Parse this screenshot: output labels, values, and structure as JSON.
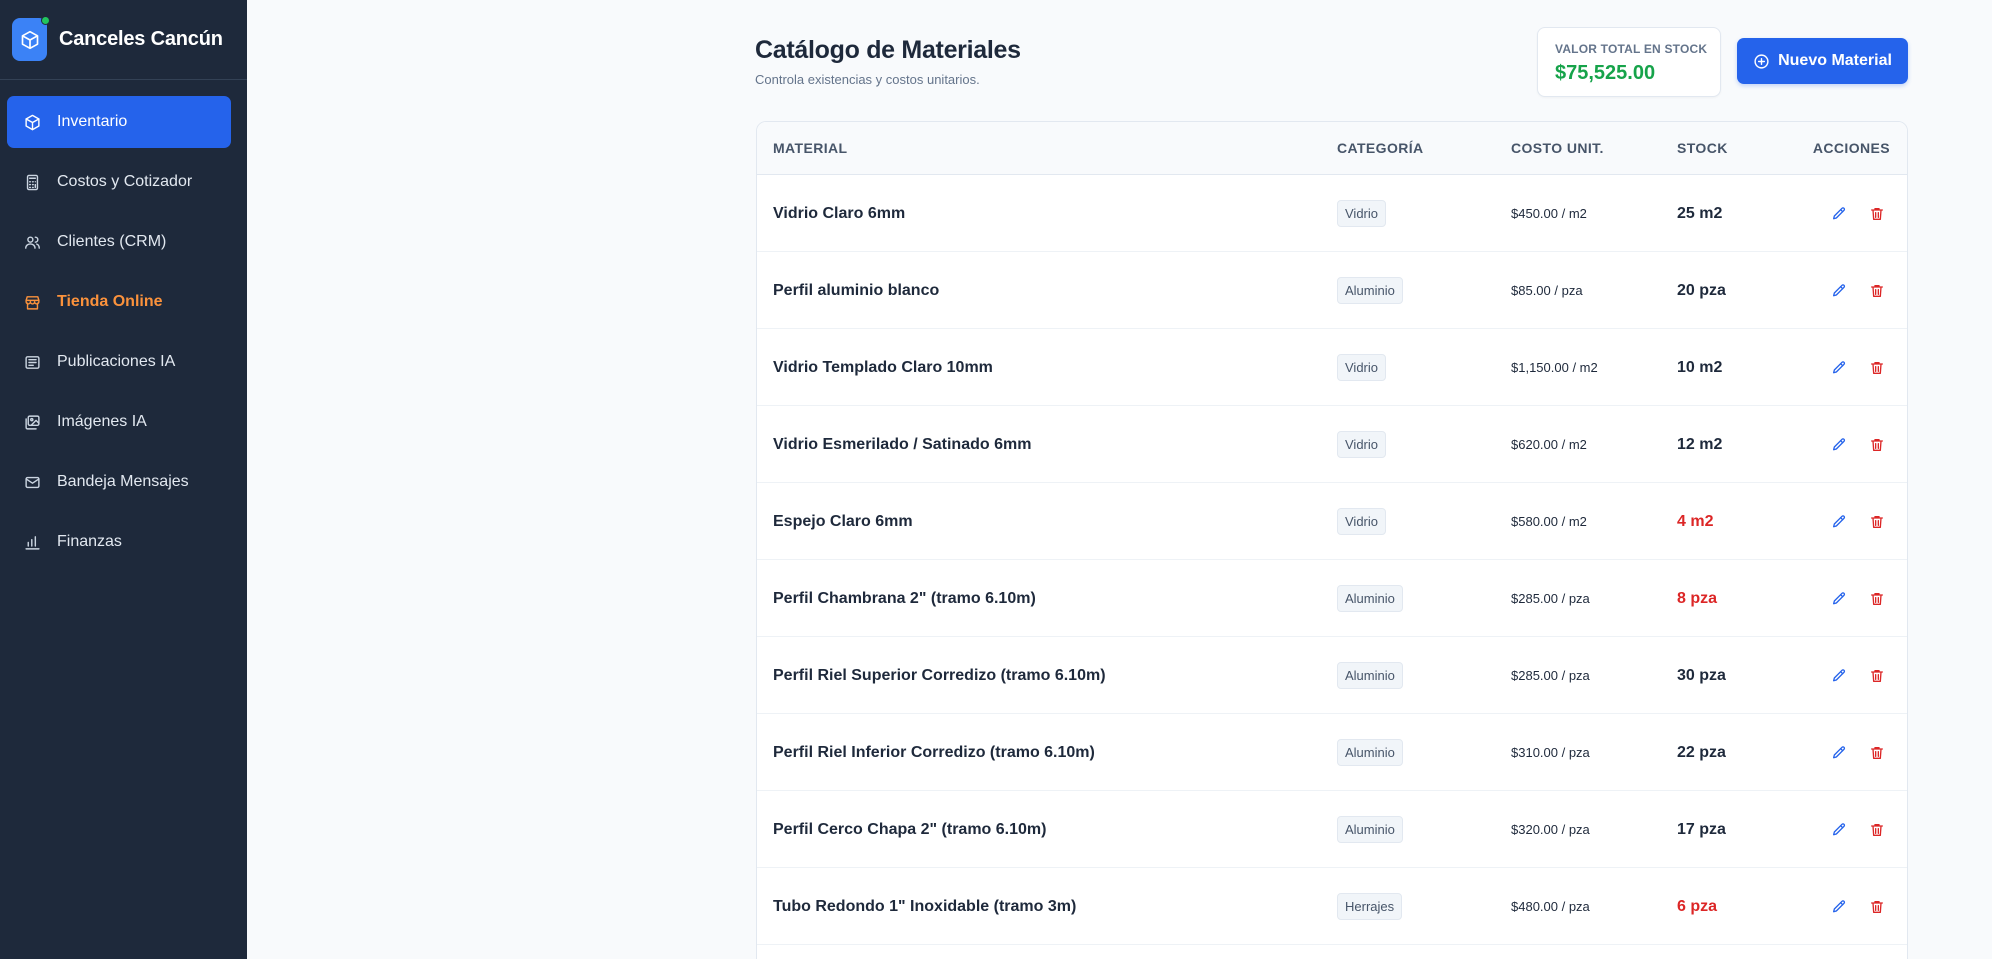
{
  "app": {
    "brand_name": "Canceles Cancún",
    "brand_icon": "box-icon"
  },
  "sidebar": {
    "items": [
      {
        "label": "Inventario",
        "icon": "box-icon",
        "state": "active"
      },
      {
        "label": "Costos y Cotizador",
        "icon": "calculator-icon",
        "state": "normal"
      },
      {
        "label": "Clientes (CRM)",
        "icon": "users-icon",
        "state": "normal"
      },
      {
        "label": "Tienda Online",
        "icon": "store-icon",
        "state": "highlight"
      },
      {
        "label": "Publicaciones IA",
        "icon": "newspaper-icon",
        "state": "normal"
      },
      {
        "label": "Imágenes IA",
        "icon": "images-icon",
        "state": "normal"
      },
      {
        "label": "Bandeja Mensajes",
        "icon": "mail-icon",
        "state": "normal"
      },
      {
        "label": "Finanzas",
        "icon": "bar-chart-icon",
        "state": "normal"
      }
    ]
  },
  "header": {
    "title": "Catálogo de Materiales",
    "subtitle": "Controla existencias y costos unitarios.",
    "stock_label": "VALOR TOTAL EN STOCK",
    "stock_value": "$75,525.00",
    "new_button_label": "Nuevo Material"
  },
  "table": {
    "columns": [
      "MATERIAL",
      "CATEGORÍA",
      "COSTO UNIT.",
      "STOCK",
      "ACCIONES"
    ],
    "rows": [
      {
        "name": "Vidrio Claro 6mm",
        "category": "Vidrio",
        "cost": "$450.00 / m2",
        "stock": "25 m2",
        "low": false
      },
      {
        "name": "Perfil aluminio blanco",
        "category": "Aluminio",
        "cost": "$85.00 / pza",
        "stock": "20 pza",
        "low": false
      },
      {
        "name": "Vidrio Templado Claro 10mm",
        "category": "Vidrio",
        "cost": "$1,150.00 / m2",
        "stock": "10 m2",
        "low": false
      },
      {
        "name": "Vidrio Esmerilado / Satinado 6mm",
        "category": "Vidrio",
        "cost": "$620.00 / m2",
        "stock": "12 m2",
        "low": false
      },
      {
        "name": "Espejo Claro 6mm",
        "category": "Vidrio",
        "cost": "$580.00 / m2",
        "stock": "4 m2",
        "low": true
      },
      {
        "name": "Perfil Chambrana 2\" (tramo 6.10m)",
        "category": "Aluminio",
        "cost": "$285.00 / pza",
        "stock": "8 pza",
        "low": true
      },
      {
        "name": "Perfil Riel Superior Corredizo (tramo 6.10m)",
        "category": "Aluminio",
        "cost": "$285.00 / pza",
        "stock": "30 pza",
        "low": false
      },
      {
        "name": "Perfil Riel Inferior Corredizo (tramo 6.10m)",
        "category": "Aluminio",
        "cost": "$310.00 / pza",
        "stock": "22 pza",
        "low": false
      },
      {
        "name": "Perfil Cerco Chapa 2\" (tramo 6.10m)",
        "category": "Aluminio",
        "cost": "$320.00 / pza",
        "stock": "17 pza",
        "low": false
      },
      {
        "name": "Tubo Redondo 1\" Inoxidable (tramo 3m)",
        "category": "Herrajes",
        "cost": "$480.00 / pza",
        "stock": "6 pza",
        "low": true
      }
    ],
    "edit_icon": "pencil-icon",
    "delete_icon": "trash-icon"
  },
  "colors": {
    "sidebar_bg": "#1e293b",
    "accent": "#2563eb",
    "highlight": "#fb923c",
    "stock_value": "#16a34a",
    "low_stock": "#dc2626",
    "status_dot": "#22c55e"
  }
}
